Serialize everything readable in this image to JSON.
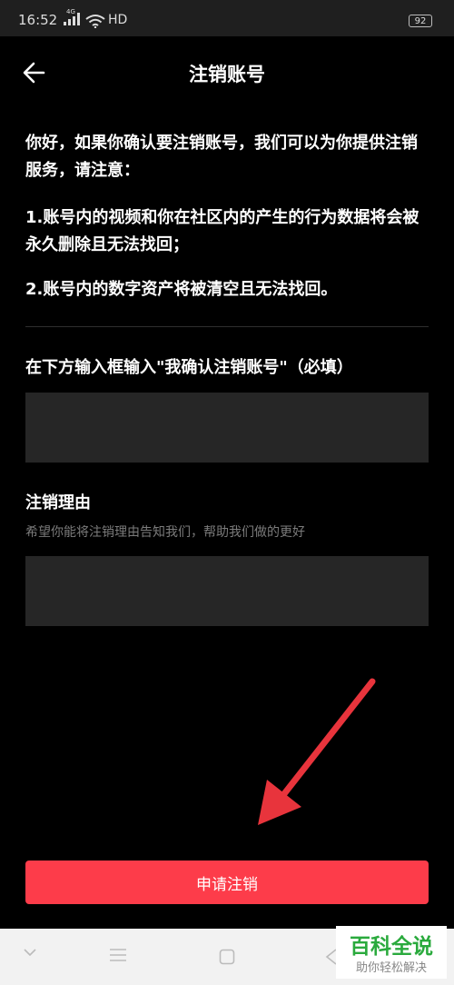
{
  "status_bar": {
    "time": "16:52",
    "network": "4G",
    "hd": "HD",
    "battery": "92"
  },
  "header": {
    "title": "注销账号"
  },
  "notice": {
    "intro": "你好，如果你确认要注销账号，我们可以为你提供注销服务，请注意：",
    "point1": "1.账号内的视频和你在社区内的产生的行为数据将会被永久删除且无法找回；",
    "point2": "2.账号内的数字资产将被清空且无法找回。"
  },
  "confirm": {
    "label": "在下方输入框输入\"我确认注销账号\"（必填）",
    "value": ""
  },
  "reason": {
    "label": "注销理由",
    "hint": "希望你能将注销理由告知我们，帮助我们做的更好",
    "value": ""
  },
  "submit_label": "申请注销",
  "watermark": {
    "title": "百科全说",
    "subtitle": "助你轻松解决"
  },
  "colors": {
    "accent": "#fd3c4a",
    "background": "#000000",
    "input_bg": "#262626",
    "annotation_arrow": "#e8343c",
    "watermark_green": "#2aaa3d"
  }
}
